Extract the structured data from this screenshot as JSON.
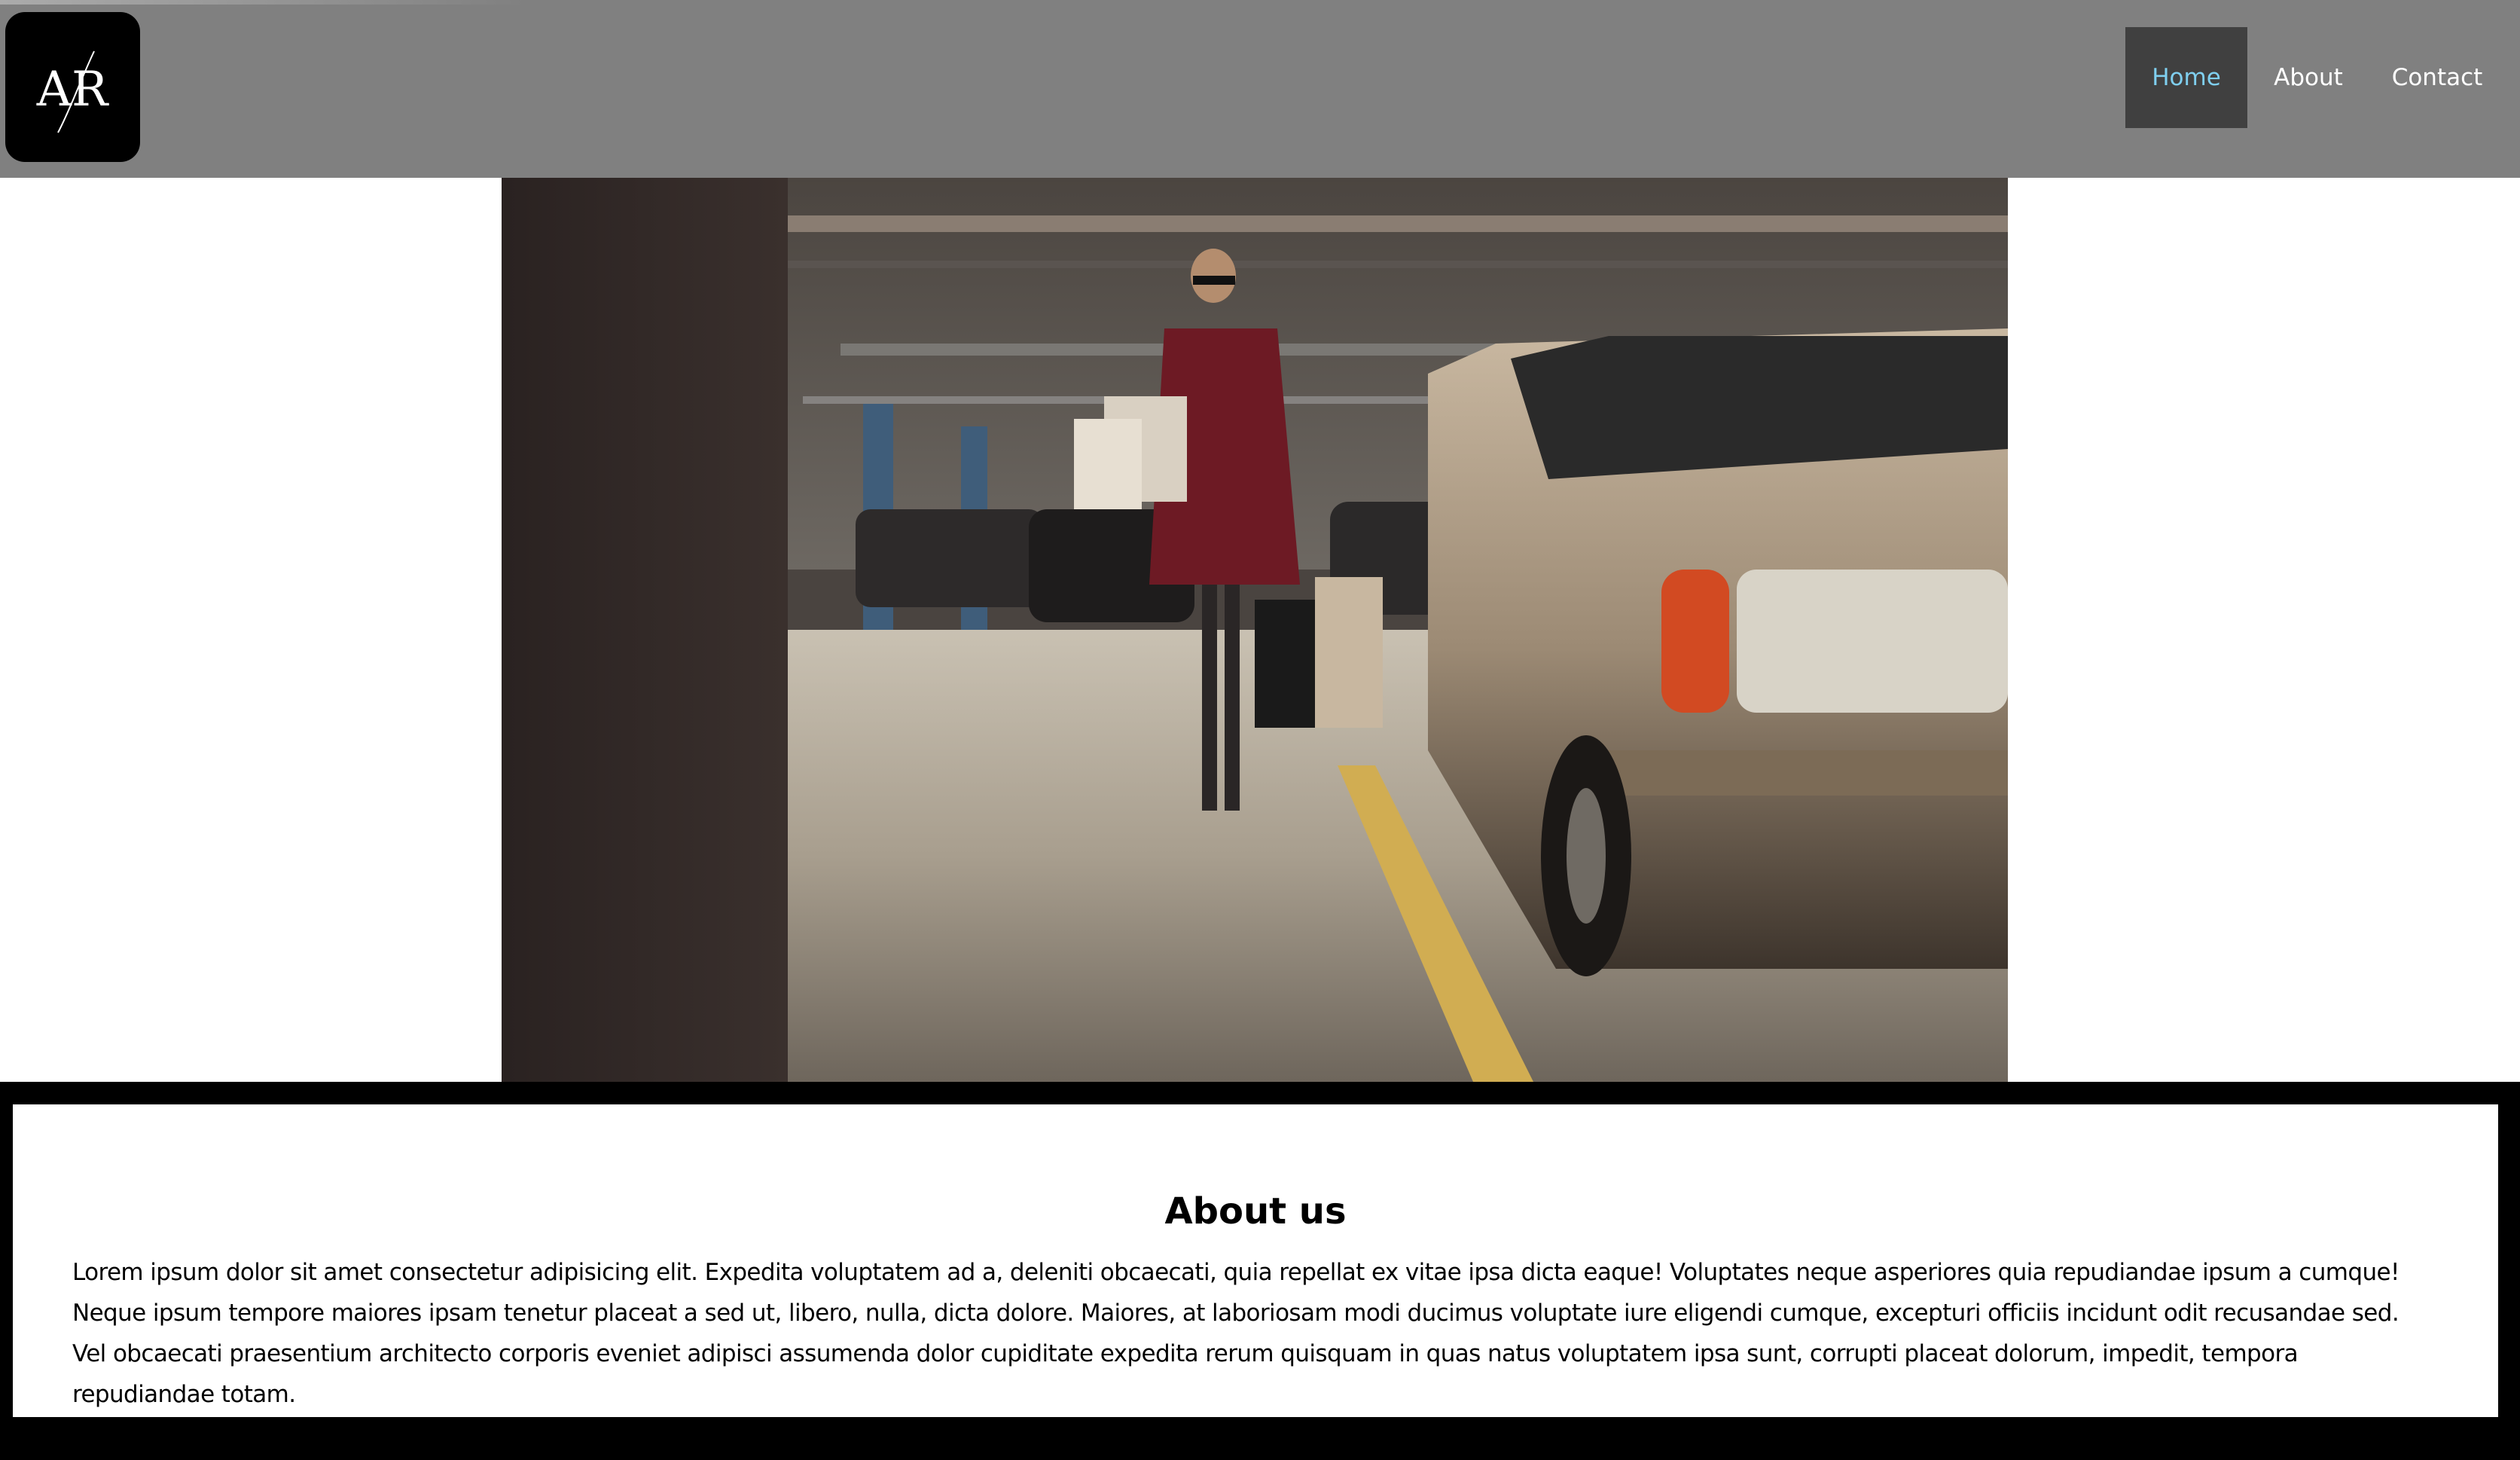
{
  "logo": {
    "text": "AR"
  },
  "nav": {
    "items": [
      {
        "label": "Home",
        "active": true
      },
      {
        "label": "About",
        "active": false
      },
      {
        "label": "Contact",
        "active": false
      }
    ]
  },
  "hero": {
    "image_icon": "hero-photo"
  },
  "about": {
    "title": "About us",
    "body": "Lorem ipsum dolor sit amet consectetur adipisicing elit. Expedita voluptatem ad a, deleniti obcaecati, quia repellat ex vitae ipsa dicta eaque! Voluptates neque asperiores quia repudiandae ipsum a cumque! Neque ipsum tempore maiores ipsam tenetur placeat a sed ut, libero, nulla, dicta dolore. Maiores, at laboriosam modi ducimus voluptate iure eligendi cumque, excepturi officiis incidunt odit recusandae sed. Vel obcaecati praesentium architecto corporis eveniet adipisci assumenda dolor cupiditate expedita rerum quisquam in quas natus voluptatem ipsa sunt, corrupti placeat dolorum, impedit, tempora repudiandae totam."
  },
  "colors": {
    "header_bg": "#808080",
    "nav_active_bg": "#404040",
    "nav_active_text": "#7fcfef",
    "nav_text": "#ffffff",
    "about_border": "#000000"
  }
}
